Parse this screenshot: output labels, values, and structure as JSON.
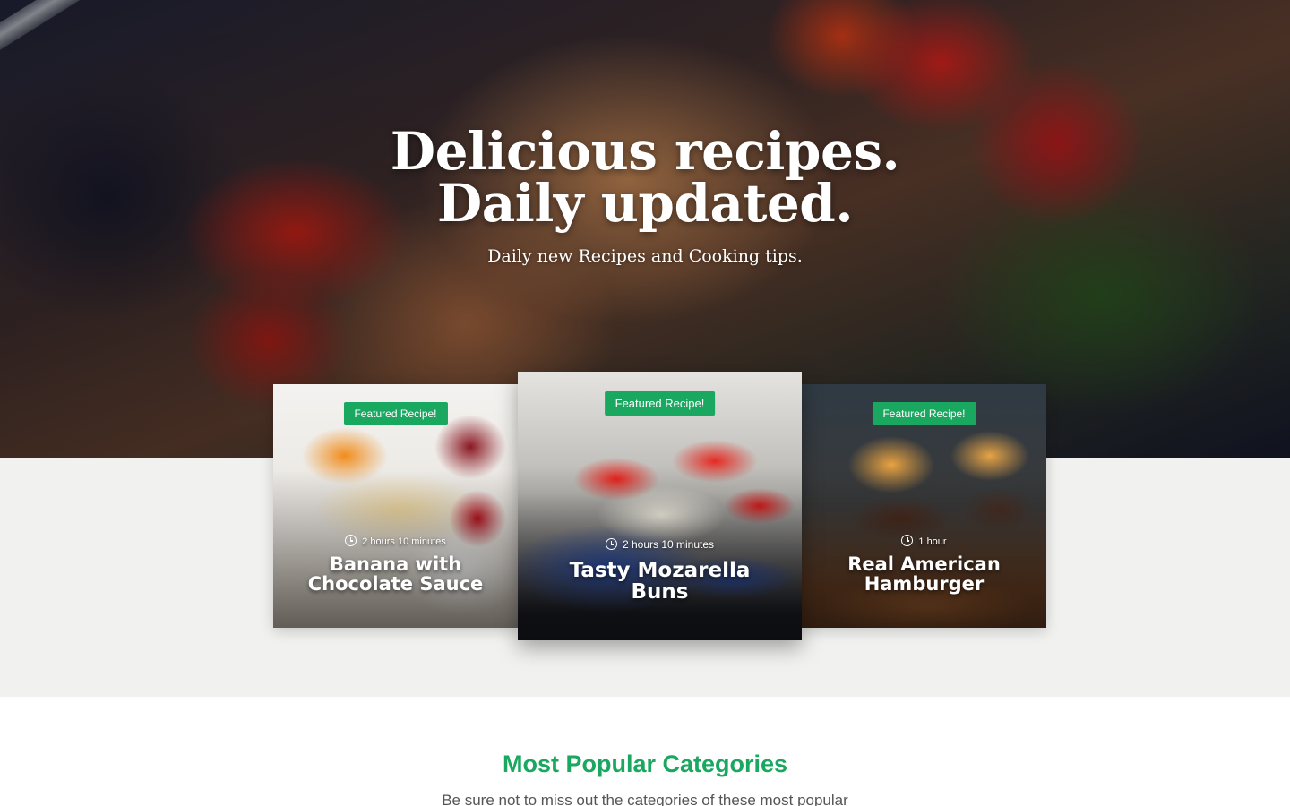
{
  "hero": {
    "title_line1": "Delicious recipes.",
    "title_line2": "Daily updated.",
    "subtitle": "Daily new Recipes and Cooking tips."
  },
  "cards": [
    {
      "badge": "Featured Recipe!",
      "time": "2 hours 10 minutes",
      "title": "Banana with Chocolate Sauce"
    },
    {
      "badge": "Featured Recipe!",
      "time": "2 hours 10 minutes",
      "title": "Tasty Mozarella Buns"
    },
    {
      "badge": "Featured Recipe!",
      "time": "1 hour",
      "title": "Real American Hamburger"
    }
  ],
  "categories": {
    "title": "Most Popular Categories",
    "subtitle": "Be sure not to miss out the categories of these most popular"
  },
  "colors": {
    "accent": "#1aa760",
    "band": "#f1f1ef"
  },
  "icons": {
    "time": "clock-icon"
  }
}
